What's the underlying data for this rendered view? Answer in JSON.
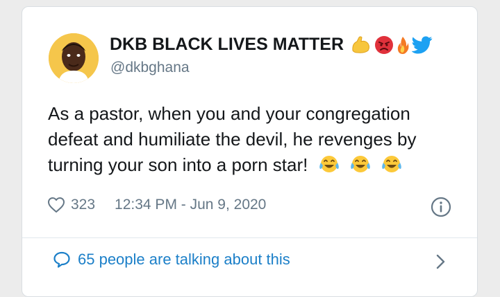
{
  "tweet": {
    "author_name": "DKB BLACK LIVES MATTER",
    "handle": "@dkbghana",
    "name_emojis": [
      "flexed-biceps-emoji",
      "angry-face-emoji",
      "fire-emoji",
      "twitter-bird-emoji"
    ],
    "text": "As a pastor, when you and your congregation defeat and humiliate the devil, he revenges by turning your son into a porn star!",
    "text_emojis": [
      "tears-of-joy-emoji",
      "tears-of-joy-emoji",
      "tears-of-joy-emoji"
    ],
    "likes": "323",
    "timestamp": "12:34 PM - Jun 9, 2020",
    "conversation_label": "65 people are talking about this"
  },
  "colors": {
    "text": "#14171a",
    "secondary": "#657786",
    "link": "#1b7fc8",
    "twitter_blue": "#1da1f2",
    "avatar_bg": "#f5c64b"
  },
  "icons": {
    "like": "heart-outline-icon",
    "info": "info-circle-icon",
    "reply": "speech-bubble-icon",
    "more": "chevron-right-icon"
  }
}
